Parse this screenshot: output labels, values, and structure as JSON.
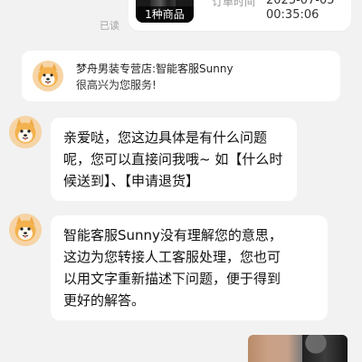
{
  "order_card": {
    "thumb_caption": "1种商品",
    "label_partial": "订单时间",
    "date_partial": "2025-07-05",
    "time": "00:35:06",
    "read_status": "已读"
  },
  "store": {
    "name": "梦舟男装专营店:智能客服Sunny",
    "greeting": "很高兴为您服务!"
  },
  "messages": [
    {
      "lines": [
        "亲爱哒，您这边具体是有什么问题",
        "呢，您可以直接问我哦~ 如【什么时",
        "候送到】、【申请退货】"
      ]
    },
    {
      "lines": [
        "智能客服Sunny没有理解您的意思，",
        "这边为您转接人工客服处理，您也可",
        "以用文字重新描述下问题，便于得到",
        "更好的解答。"
      ]
    }
  ],
  "icons": {
    "avatar": "shiba-dog-avatar-icon",
    "product": "product-thumbnail",
    "photo": "image-preview"
  },
  "colors": {
    "background": "#f2f2f2",
    "card": "#ffffff",
    "text": "#111111",
    "muted": "#9a9a9a"
  }
}
